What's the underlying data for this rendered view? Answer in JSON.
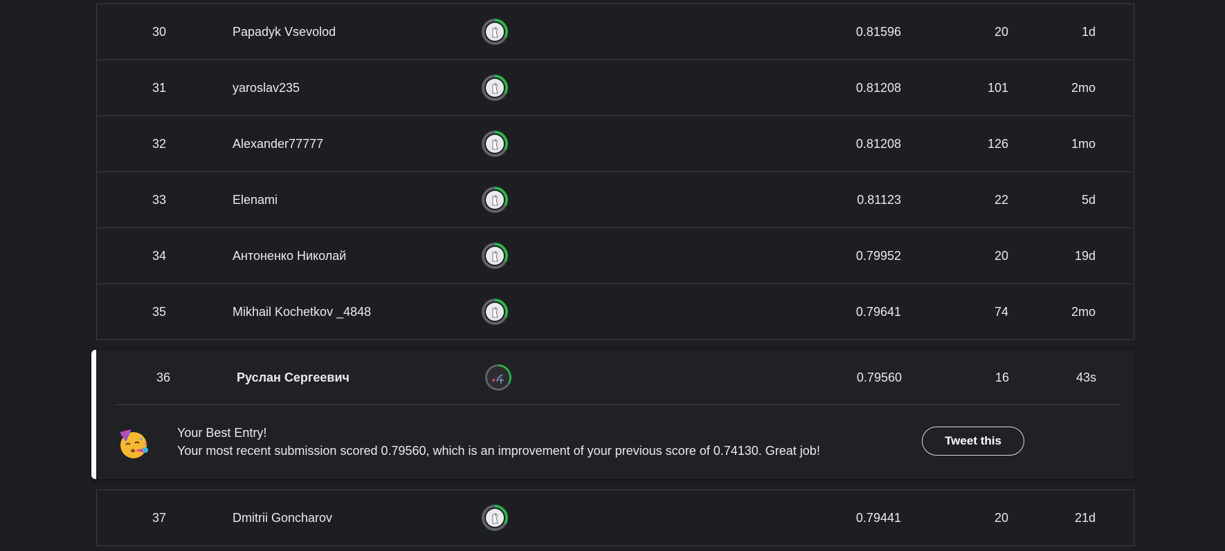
{
  "leaderboard": {
    "rows_top": [
      {
        "rank": "30",
        "name": "Papadyk Vsevolod",
        "score": "0.81596",
        "entries": "20",
        "last": "1d"
      },
      {
        "rank": "31",
        "name": "yaroslav235",
        "score": "0.81208",
        "entries": "101",
        "last": "2mo"
      },
      {
        "rank": "32",
        "name": "Alexander77777",
        "score": "0.81208",
        "entries": "126",
        "last": "1mo"
      },
      {
        "rank": "33",
        "name": "Elenami",
        "score": "0.81123",
        "entries": "22",
        "last": "5d"
      },
      {
        "rank": "34",
        "name": "Антоненко Николай",
        "score": "0.79952",
        "entries": "20",
        "last": "19d"
      },
      {
        "rank": "35",
        "name": "Mikhail Kochetkov _4848",
        "score": "0.79641",
        "entries": "74",
        "last": "2mo"
      }
    ],
    "current_user": {
      "rank": "36",
      "name": "Руслан Сергеевич",
      "score": "0.79560",
      "entries": "16",
      "last": "43s"
    },
    "rows_bottom": [
      {
        "rank": "37",
        "name": "Dmitrii Goncharov",
        "score": "0.79441",
        "entries": "20",
        "last": "21d"
      }
    ]
  },
  "notice": {
    "title": "Your Best Entry!",
    "text": "Your most recent submission scored 0.79560, which is an improvement of your previous score of 0.74130. Great job!",
    "button_label": "Tweet this",
    "icon": "party-face-icon"
  },
  "colors": {
    "background": "#1d1e21",
    "border": "#3c3d41",
    "progress_ring": "#2db24e",
    "highlight_bar": "#ffffff"
  }
}
